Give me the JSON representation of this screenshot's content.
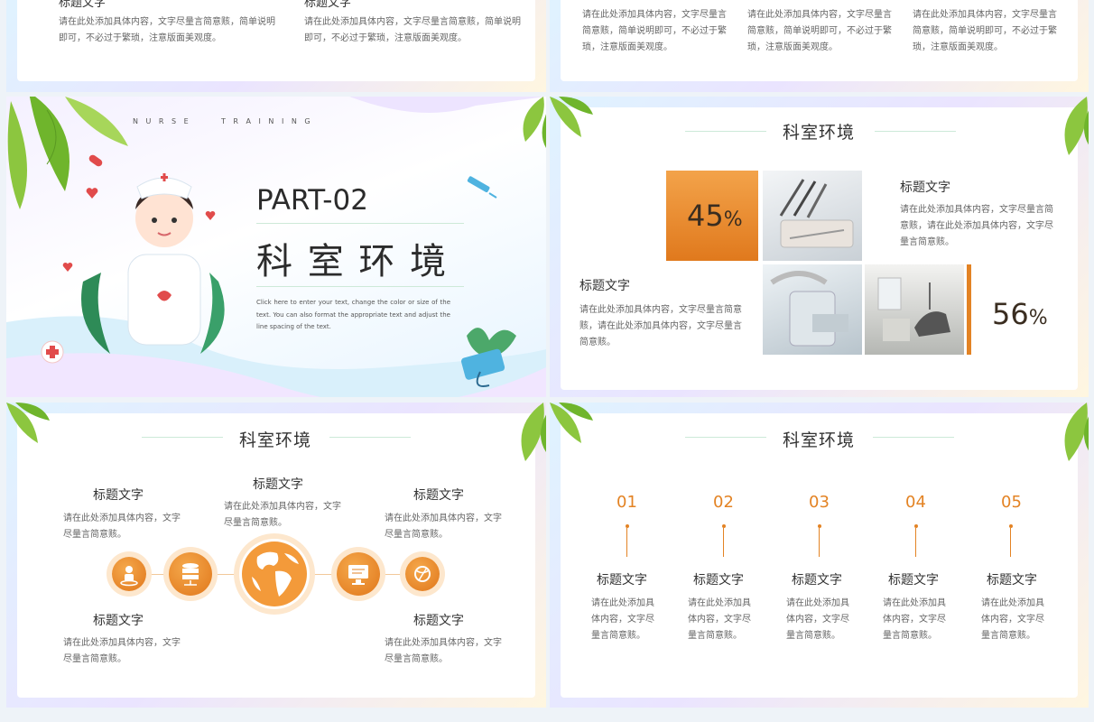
{
  "top_left": {
    "heading_a": "标题文字",
    "heading_b": "标题文字",
    "text_a": "请在此处添加具体内容，文字尽量言简意赅，简单说明即可，不必过于繁琐，注意版面美观度。",
    "text_b": "请在此处添加具体内容，文字尽量言简意赅，简单说明即可，不必过于繁琐，注意版面美观度。"
  },
  "top_right": {
    "texts": [
      "请在此处添加具体内容，文字尽量言简意赅，简单说明即可，不必过于繁琐，注意版面美观度。",
      "请在此处添加具体内容，文字尽量言简意赅，简单说明即可，不必过于繁琐，注意版面美观度。",
      "请在此处添加具体内容，文字尽量言简意赅，简单说明即可，不必过于繁琐，注意版面美观度。"
    ]
  },
  "section": {
    "tag": "N U R S E      T R A I N I N G",
    "part": "PART-02",
    "title": "科 室 环 境",
    "desc": "Click here to enter your text, change the color or size of the text. You can also format the appropriate text and adjust the line spacing of the text."
  },
  "percent_slide": {
    "title": "科室环境",
    "pct_a": "45",
    "pct_b": "56",
    "pct_sign": "%",
    "h1": "标题文字",
    "t1": "请在此处添加具体内容，文字尽量言简意赅，请在此处添加具体内容，文字尽量言简意赅。",
    "h2": "标题文字",
    "t2": "请在此处添加具体内容，文字尽量言简意赅，请在此处添加具体内容，文字尽量言简意赅。"
  },
  "icons_slide": {
    "title": "科室环境",
    "items": [
      {
        "h": "标题文字",
        "t": "请在此处添加具体内容，文字尽量言简意赅。"
      },
      {
        "h": "标题文字",
        "t": "请在此处添加具体内容，文字尽量言简意赅。"
      },
      {
        "h": "标题文字",
        "t": "请在此处添加具体内容，文字尽量言简意赅。"
      },
      {
        "h": "标题文字",
        "t": "请在此处添加具体内容，文字尽量言简意赅。"
      },
      {
        "h": "标题文字",
        "t": "请在此处添加具体内容，文字尽量言简意赅。"
      }
    ]
  },
  "steps_slide": {
    "title": "科室环境",
    "steps": [
      {
        "n": "01",
        "h": "标题文字",
        "t": "请在此处添加具体内容，文字尽量言简意赅。"
      },
      {
        "n": "02",
        "h": "标题文字",
        "t": "请在此处添加具体内容，文字尽量言简意赅。"
      },
      {
        "n": "03",
        "h": "标题文字",
        "t": "请在此处添加具体内容，文字尽量言简意赅。"
      },
      {
        "n": "04",
        "h": "标题文字",
        "t": "请在此处添加具体内容，文字尽量言简意赅。"
      },
      {
        "n": "05",
        "h": "标题文字",
        "t": "请在此处添加具体内容，文字尽量言简意赅。"
      }
    ]
  },
  "colors": {
    "accent": "#e38324",
    "leaf": "#7cc04a",
    "line": "#cde9d8"
  }
}
